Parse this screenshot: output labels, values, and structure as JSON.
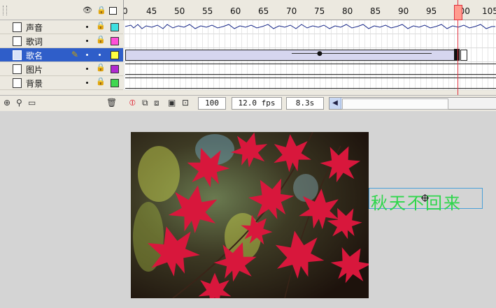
{
  "timeline": {
    "ruler": [
      "0",
      "45",
      "50",
      "55",
      "60",
      "65",
      "70",
      "75",
      "80",
      "85",
      "90",
      "95",
      "100",
      "105"
    ],
    "layers": [
      {
        "name": "声音",
        "color": "#3fe0e0",
        "selected": false
      },
      {
        "name": "歌词",
        "color": "#ff4fd8",
        "selected": false
      },
      {
        "name": "歌名",
        "color": "#ffff40",
        "selected": true
      },
      {
        "name": "图片",
        "color": "#b02ad0",
        "selected": false
      },
      {
        "name": "背景",
        "color": "#40d850",
        "selected": false
      }
    ],
    "footer": {
      "frame": "100",
      "fps": "12.0 fps",
      "time": "8.3s"
    }
  },
  "stage": {
    "text_object": "秋天不回来"
  }
}
